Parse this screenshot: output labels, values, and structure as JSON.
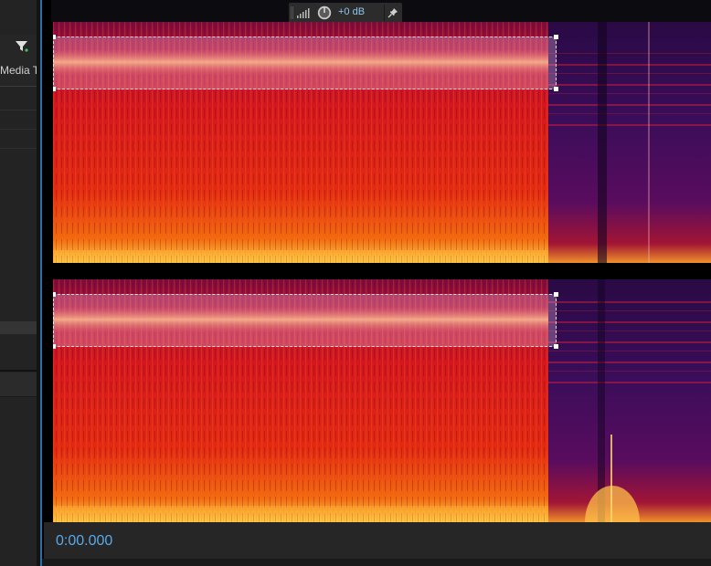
{
  "left_panel": {
    "column_label": "Media Ty",
    "filter_icon": "filter-icon"
  },
  "hud": {
    "gain_value": "+0 dB",
    "icons": [
      "level-meter-icon",
      "volume-knob-icon",
      "pin-icon"
    ]
  },
  "spectral_view": {
    "channels": 2,
    "selection": "marquee"
  },
  "status": {
    "current_time": "0:00.000"
  },
  "colors": {
    "accent": "#5aa9e6",
    "frame": "#2b6fa8"
  }
}
